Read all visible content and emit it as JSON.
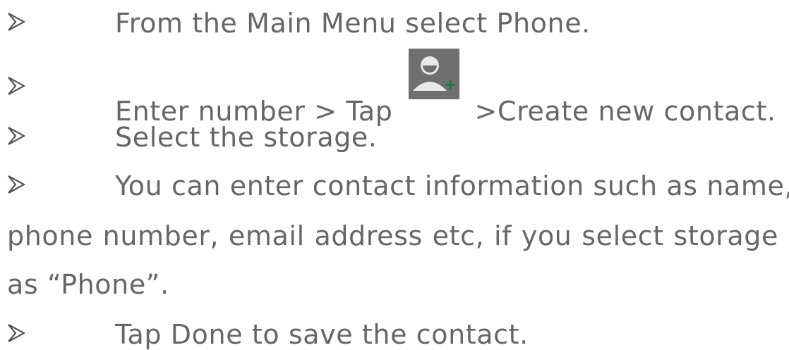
{
  "steps": [
    {
      "text": "From the Main Menu select Phone."
    },
    {
      "text_before": "Enter number > Tap",
      "text_after": ">Create new contact.",
      "icon": "add-contact-icon"
    },
    {
      "text": "Select the storage."
    },
    {
      "text_first": "You can enter contact information such as name,",
      "text_second": "phone number, email address etc, if you select storage",
      "text_third": "as “Phone”."
    },
    {
      "text": "Tap Done to save the contact."
    }
  ],
  "colors": {
    "text": "#666666",
    "icon_bg": "#6f6f6f",
    "icon_fg": "#e8e8e8",
    "icon_plus": "#1e7a3a"
  }
}
